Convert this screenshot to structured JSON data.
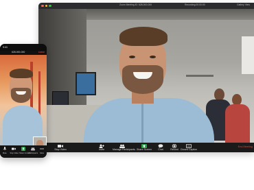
{
  "desktop": {
    "title": "Zoom Meeting ID: 628-000-000",
    "recording": "Recording 00:00:00",
    "view_label": "Gallery View",
    "traffic_lights": [
      "#ff5f57",
      "#febc2e",
      "#28c840"
    ],
    "toolbar": [
      {
        "label": "Stop Video",
        "icon": "video-camera-icon"
      },
      {
        "label": "Invite",
        "icon": "add-user-icon"
      },
      {
        "label": "Manage Participants",
        "icon": "participants-icon"
      },
      {
        "label": "Share Screen",
        "icon": "share-screen-icon"
      },
      {
        "label": "Chat",
        "icon": "chat-icon"
      },
      {
        "label": "Record",
        "icon": "record-icon"
      },
      {
        "label": "Closed Caption",
        "icon": "cc-icon"
      }
    ],
    "end_label": "End Meeting"
  },
  "phone": {
    "time": "9:41",
    "meeting_id": "628-000-000",
    "leave_label": "Leave",
    "toolbar": [
      {
        "label": "Mute",
        "icon": "microphone-icon"
      },
      {
        "label": "Stop Video",
        "icon": "video-camera-icon"
      },
      {
        "label": "Share Content",
        "icon": "share-icon"
      },
      {
        "label": "Participants",
        "icon": "participants-icon"
      },
      {
        "label": "More",
        "icon": "more-icon"
      }
    ]
  },
  "colors": {
    "share_accent": "#2aa34a",
    "end_red": "#e0473c"
  }
}
